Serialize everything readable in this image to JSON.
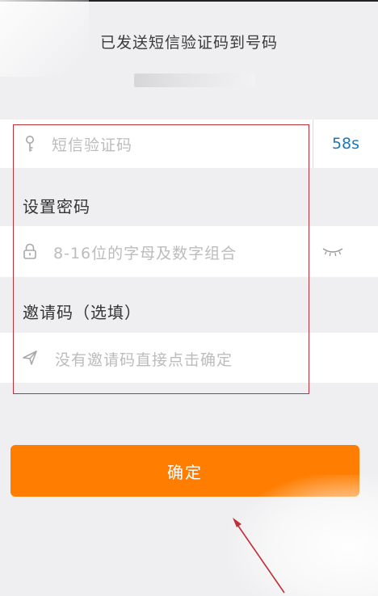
{
  "header": {
    "title": "已发送短信验证码到号码"
  },
  "sms_field": {
    "icon": "key-icon",
    "placeholder": "短信验证码",
    "countdown": "58s"
  },
  "password_section": {
    "label": "设置密码",
    "icon": "lock-icon",
    "placeholder": "8-16位的字母及数字组合",
    "toggle_icon": "eye-closed-icon"
  },
  "invite_section": {
    "label": "邀请码（选填）",
    "icon": "send-icon",
    "placeholder": "没有邀请码直接点击确定"
  },
  "confirm_button": {
    "label": "确定"
  },
  "colors": {
    "accent": "#ff7d00",
    "link": "#1a78b8",
    "annotation": "#c0303a",
    "background": "#efeff1"
  }
}
